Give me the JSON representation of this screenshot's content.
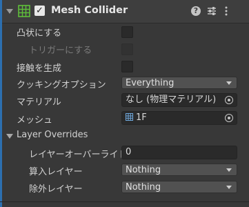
{
  "header": {
    "title": "Mesh Collider",
    "enabled": "✓",
    "help_icon": "?",
    "icons": [
      "grid-icon",
      "help-icon",
      "presets-icon",
      "more-icon"
    ]
  },
  "rows": {
    "convex_label": "凸状にする",
    "trigger_label": "トリガーにする",
    "contacts_label": "接触を生成",
    "cooking_label": "クッキングオプション",
    "cooking_value": "Everything",
    "material_label": "マテリアル",
    "material_value": "なし (物理マテリアル)",
    "mesh_label": "メッシュ",
    "mesh_value": "1F"
  },
  "layer_overrides": {
    "section_label": "Layer Overrides",
    "priority_label": "レイヤーオーバーライド",
    "priority_value": "0",
    "include_label": "算入レイヤー",
    "include_value": "Nothing",
    "exclude_label": "除外レイヤー",
    "exclude_value": "Nothing"
  },
  "colors": {
    "background": "#383838",
    "header": "#3e3e3e",
    "accent": "#2c6fb0",
    "icon_green": "#5fbf3a"
  }
}
